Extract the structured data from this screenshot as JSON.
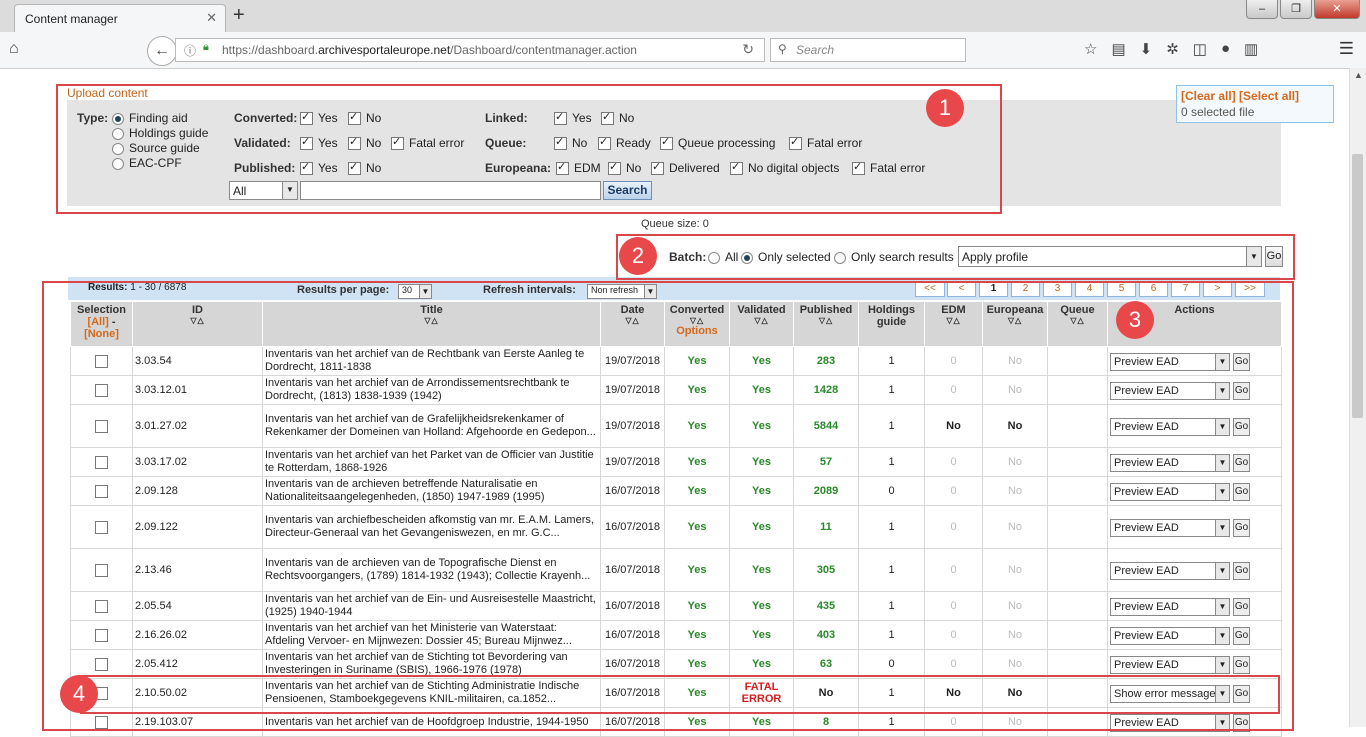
{
  "browser": {
    "tab_title": "Content manager",
    "tab_close": "✕",
    "new_tab": "+",
    "url_prefix": "https://dashboard.",
    "url_domain": "archivesportaleurope.net",
    "url_path": "/Dashboard/contentmanager.action",
    "search_placeholder": "Search",
    "window_buttons": [
      "‒",
      "❐",
      "✕"
    ]
  },
  "upload": {
    "label": "Upload content"
  },
  "filters": {
    "type_label": "Type:",
    "type_options": [
      "Finding aid",
      "Holdings guide",
      "Source guide",
      "EAC-CPF"
    ],
    "converted": {
      "label": "Converted:",
      "options": [
        "Yes",
        "No"
      ]
    },
    "validated": {
      "label": "Validated:",
      "options": [
        "Yes",
        "No",
        "Fatal error"
      ]
    },
    "published": {
      "label": "Published:",
      "options": [
        "Yes",
        "No"
      ]
    },
    "linked": {
      "label": "Linked:",
      "options": [
        "Yes",
        "No"
      ]
    },
    "queue": {
      "label": "Queue:",
      "options": [
        "No",
        "Ready",
        "Queue processing",
        "Fatal error"
      ]
    },
    "europeana": {
      "label": "Europeana:",
      "options": [
        "EDM",
        "No",
        "Delivered",
        "No digital objects",
        "Fatal error"
      ]
    },
    "scope_value": "All",
    "search_button": "Search"
  },
  "selection_panel": {
    "clear": "[Clear all]",
    "select": "[Select all]",
    "count": "0 selected file"
  },
  "queue_size": "Queue size: 0",
  "batch": {
    "label": "Batch:",
    "options": [
      "All",
      "Only selected",
      "Only search results"
    ],
    "profile": "Apply profile",
    "go": "Go"
  },
  "results": {
    "label": "Results:",
    "range": "1 - 30 / 6878",
    "per_page_label": "Results per page:",
    "per_page": "30",
    "refresh_label": "Refresh intervals:",
    "refresh": "Non refresh",
    "pages": [
      "<<",
      "<",
      "1",
      "2",
      "3",
      "4",
      "5",
      "6",
      "7",
      ">",
      ">>"
    ]
  },
  "columns": {
    "selection": "Selection",
    "all": "[All]",
    "none": "[None]",
    "id": "ID",
    "title": "Title",
    "date": "Date",
    "converted": "Converted",
    "options": "Options",
    "validated": "Validated",
    "published": "Published",
    "holdings": "Holdings guide",
    "edm": "EDM",
    "europeana": "Europeana",
    "queue": "Queue",
    "actions": "Actions",
    "sort": "▽△"
  },
  "rows": [
    {
      "id": "3.03.54",
      "title": "Inventaris van het archief van de Rechtbank van Eerste Aanleg te Dordrecht, 1811-1838",
      "date": "19/07/2018",
      "converted": "Yes",
      "validated": "Yes",
      "published": "283",
      "holdings": "1",
      "edm": "0",
      "europeana": "No",
      "action": "Preview EAD",
      "go": "Go"
    },
    {
      "id": "3.03.12.01",
      "title": "Inventaris van het archief van de Arrondissementsrechtbank te Dordrecht, (1813) 1838-1939 (1942)",
      "date": "19/07/2018",
      "converted": "Yes",
      "validated": "Yes",
      "published": "1428",
      "holdings": "1",
      "edm": "0",
      "europeana": "No",
      "action": "Preview EAD",
      "go": "Go"
    },
    {
      "id": "3.01.27.02",
      "title": "Inventaris van het archief van de Grafelijkheidsrekenkamer of Rekenkamer der Domeinen van Holland: Afgehoorde en Gedepon...",
      "date": "19/07/2018",
      "converted": "Yes",
      "validated": "Yes",
      "published": "5844",
      "holdings": "1",
      "edm": "No",
      "europeana": "No",
      "action": "Preview EAD",
      "go": "Go"
    },
    {
      "id": "3.03.17.02",
      "title": "Inventaris van het archief van het Parket van de Officier van Justitie te Rotterdam, 1868-1926",
      "date": "19/07/2018",
      "converted": "Yes",
      "validated": "Yes",
      "published": "57",
      "holdings": "1",
      "edm": "0",
      "europeana": "No",
      "action": "Preview EAD",
      "go": "Go"
    },
    {
      "id": "2.09.128",
      "title": "Inventaris van de archieven betreffende Naturalisatie en Nationaliteitsaangelegenheden, (1850) 1947-1989 (1995)",
      "date": "16/07/2018",
      "converted": "Yes",
      "validated": "Yes",
      "published": "2089",
      "holdings": "0",
      "edm": "0",
      "europeana": "No",
      "action": "Preview EAD",
      "go": "Go"
    },
    {
      "id": "2.09.122",
      "title": "Inventaris van archiefbescheiden afkomstig van mr. E.A.M. Lamers, Directeur-Generaal van het Gevangeniswezen, en mr. G.C...",
      "date": "16/07/2018",
      "converted": "Yes",
      "validated": "Yes",
      "published": "11",
      "holdings": "1",
      "edm": "0",
      "europeana": "No",
      "action": "Preview EAD",
      "go": "Go"
    },
    {
      "id": "2.13.46",
      "title": "Inventaris van de archieven van de Topografische Dienst en Rechtsvoorgangers, (1789) 1814-1932 (1943); Collectie Krayenh...",
      "date": "16/07/2018",
      "converted": "Yes",
      "validated": "Yes",
      "published": "305",
      "holdings": "1",
      "edm": "0",
      "europeana": "No",
      "action": "Preview EAD",
      "go": "Go"
    },
    {
      "id": "2.05.54",
      "title": "Inventaris van het archief van de Ein- und Ausreisestelle Maastricht, (1925) 1940-1944",
      "date": "16/07/2018",
      "converted": "Yes",
      "validated": "Yes",
      "published": "435",
      "holdings": "1",
      "edm": "0",
      "europeana": "No",
      "action": "Preview EAD",
      "go": "Go"
    },
    {
      "id": "2.16.26.02",
      "title": "Inventaris van het archief van het Ministerie van Waterstaat: Afdeling Vervoer- en Mijnwezen: Dossier 45; Bureau Mijnwez...",
      "date": "16/07/2018",
      "converted": "Yes",
      "validated": "Yes",
      "published": "403",
      "holdings": "1",
      "edm": "0",
      "europeana": "No",
      "action": "Preview EAD",
      "go": "Go"
    },
    {
      "id": "2.05.412",
      "title": "Inventaris van het archief van de Stichting tot Bevordering van Investeringen in Suriname (SBIS), 1966-1976 (1978)",
      "date": "16/07/2018",
      "converted": "Yes",
      "validated": "Yes",
      "published": "63",
      "holdings": "0",
      "edm": "0",
      "europeana": "No",
      "action": "Preview EAD",
      "go": "Go"
    },
    {
      "id": "2.10.50.02",
      "title": "Inventaris van het archief van de Stichting Administratie Indische Pensioenen, Stamboekgegevens KNIL-militairen, ca.1852...",
      "date": "16/07/2018",
      "converted": "Yes",
      "validated": "FATAL ERROR",
      "published": "No",
      "holdings": "1",
      "edm": "No",
      "europeana": "No",
      "action": "Show error message",
      "go": "Go"
    },
    {
      "id": "2.19.103.07",
      "title": "Inventaris van het archief van de Hoofdgroep Industrie, 1944-1950",
      "date": "16/07/2018",
      "converted": "Yes",
      "validated": "Yes",
      "published": "8",
      "holdings": "1",
      "edm": "0",
      "europeana": "No",
      "action": "Preview EAD",
      "go": "Go"
    }
  ],
  "markers": [
    "1",
    "2",
    "3",
    "4"
  ],
  "colors": {
    "accent_orange": "#d4691b",
    "yes_green": "#2a8a2a",
    "error_red": "#d21e1e",
    "marker_red": "#e8484a"
  }
}
